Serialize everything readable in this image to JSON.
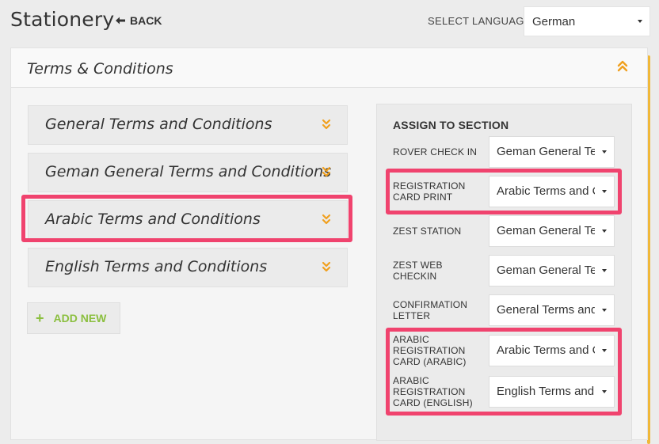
{
  "header": {
    "title": "Stationery",
    "back_label": "BACK",
    "back_icon": "left-arrow-icon",
    "language_label": "SELECT LANGUAGE",
    "language_value": "German"
  },
  "panel": {
    "title": "Terms & Conditions",
    "collapse_icon": "double-chevron-up-icon"
  },
  "terms": [
    {
      "label": "General Terms and Conditions"
    },
    {
      "label": "Geman General Terms and Conditions"
    },
    {
      "label": "Arabic Terms and Conditions"
    },
    {
      "label": "English Terms and Conditions"
    }
  ],
  "add_new_label": "ADD NEW",
  "assign": {
    "title": "ASSIGN TO SECTION",
    "rows": [
      {
        "label": "ROVER CHECK IN",
        "value": "Geman General Terms and Conditions"
      },
      {
        "label": "REGISTRATION CARD PRINT",
        "value": "Arabic Terms and Conditions"
      },
      {
        "label": "ZEST STATION",
        "value": "Geman General Terms and Conditions"
      },
      {
        "label": "ZEST WEB CHECKIN",
        "value": "Geman General Terms and Conditions"
      },
      {
        "label": "CONFIRMATION LETTER",
        "value": "General Terms and Conditions"
      },
      {
        "label": "ARABIC REGISTRATION CARD (ARABIC)",
        "value": "Arabic Terms and Conditions"
      },
      {
        "label": "ARABIC REGISTRATION CARD (ENGLISH)",
        "value": "English Terms and Conditions"
      }
    ]
  },
  "colors": {
    "accent_orange": "#f0a01e",
    "highlight_pink": "#f0436e",
    "add_green": "#8bbf3f"
  }
}
